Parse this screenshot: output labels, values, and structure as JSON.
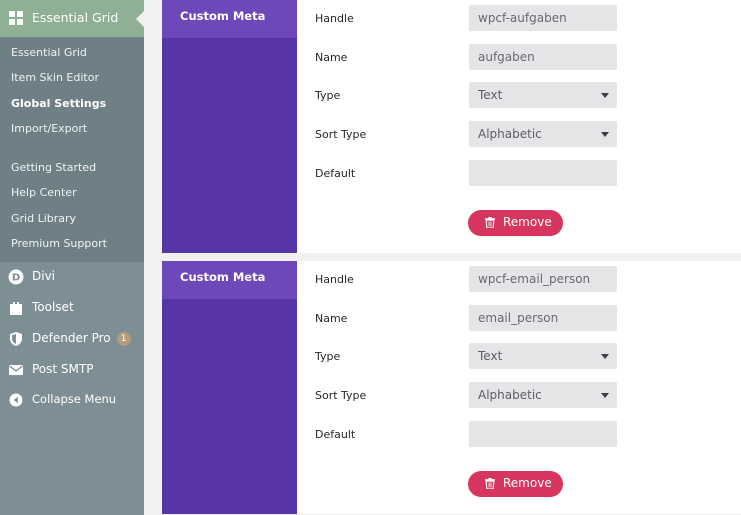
{
  "sidebar": {
    "header": {
      "label": "Essential Grid",
      "icon": "grid-icon"
    },
    "submenu": [
      {
        "label": "Essential Grid"
      },
      {
        "label": "Item Skin Editor"
      },
      {
        "label": "Global Settings",
        "active": true
      },
      {
        "label": "Import/Export"
      },
      {
        "label": "Getting Started"
      },
      {
        "label": "Help Center"
      },
      {
        "label": "Grid Library"
      },
      {
        "label": "Premium Support"
      }
    ],
    "menu": [
      {
        "label": "Divi",
        "icon": "divi-icon"
      },
      {
        "label": "Toolset",
        "icon": "toolset-icon"
      },
      {
        "label": "Defender Pro",
        "icon": "shield-icon",
        "badge": "1"
      },
      {
        "label": "Post SMTP",
        "icon": "envelope-icon"
      },
      {
        "label": "Collapse Menu",
        "icon": "collapse-icon"
      }
    ]
  },
  "panels": [
    {
      "tab": "Custom Meta",
      "labels": {
        "handle": "Handle",
        "name": "Name",
        "type": "Type",
        "sort_type": "Sort Type",
        "default": "Default"
      },
      "values": {
        "handle": "wpcf-aufgaben",
        "name": "aufgaben",
        "type": "Text",
        "sort_type": "Alphabetic",
        "default": ""
      },
      "remove": "Remove"
    },
    {
      "tab": "Custom Meta",
      "labels": {
        "handle": "Handle",
        "name": "Name",
        "type": "Type",
        "sort_type": "Sort Type",
        "default": "Default"
      },
      "values": {
        "handle": "wpcf-email_person",
        "name": "email_person",
        "type": "Text",
        "sort_type": "Alphabetic",
        "default": ""
      },
      "remove": "Remove"
    }
  ],
  "colors": {
    "accent": "#5734a8",
    "remove": "#d6365e",
    "sidebar": "#7d8f94"
  }
}
